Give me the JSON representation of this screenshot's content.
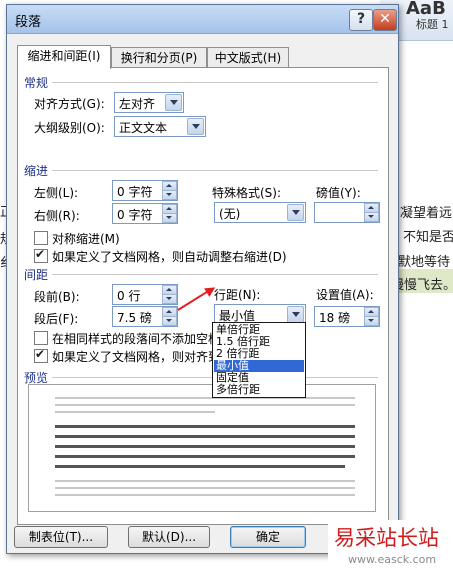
{
  "document_bg": {
    "ribbon_title": "AaB",
    "ribbon_style": "标题 1",
    "right_texts": [
      "凝望着远",
      "不知是否",
      "默地等待",
      "慢慢飞去。"
    ],
    "left_texts": [
      "正",
      "规",
      "纟"
    ]
  },
  "dialog": {
    "title": "段落",
    "help_label": "?",
    "close_label": "✕",
    "tabs": [
      "缩进和间距(I)",
      "换行和分页(P)",
      "中文版式(H)"
    ],
    "general": {
      "section_label": "常规",
      "alignment_label": "对齐方式(G):",
      "alignment_value": "左对齐",
      "outline_label": "大纲级别(O):",
      "outline_value": "正文文本"
    },
    "indent": {
      "section_label": "缩进",
      "left_label": "左侧(L):",
      "left_value": "0 字符",
      "right_label": "右侧(R):",
      "right_value": "0 字符",
      "special_label": "特殊格式(S):",
      "special_value": "(无)",
      "by_label": "磅值(Y):",
      "by_value": "",
      "mirror_label": "对称缩进(M)",
      "mirror_checked": false,
      "auto_adjust_label": "如果定义了文档网格，则自动调整右缩进(D)",
      "auto_adjust_checked": true
    },
    "spacing": {
      "section_label": "间距",
      "before_label": "段前(B):",
      "before_value": "0 行",
      "after_label": "段后(F):",
      "after_value": "7.5 磅",
      "line_spacing_label": "行距(N):",
      "line_spacing_value": "最小值",
      "at_label": "设置值(A):",
      "at_value": "18 磅",
      "no_space_label": "在相同样式的段落间不添加空格",
      "no_space_checked": false,
      "snap_label": "如果定义了文档网格，则对齐到",
      "snap_checked": true,
      "line_spacing_options": [
        "单倍行距",
        "1.5 倍行距",
        "2 倍行距",
        "最小值",
        "固定值",
        "多倍行距"
      ],
      "selected_option_index": 3
    },
    "preview": {
      "section_label": "预览"
    },
    "buttons": {
      "tabs_label": "制表位(T)...",
      "default_label": "默认(D)...",
      "ok_label": "确定"
    }
  },
  "watermark": {
    "line1": "易采站长站",
    "line2": "www.easck.com"
  },
  "colors": {
    "title_gradient_top": "#c7dcf5",
    "close_button": "#c43b1d",
    "section_label": "#1e3287",
    "selection": "#3168d5",
    "annotation_arrow": "#e02020",
    "watermark": "#d01c1c"
  }
}
